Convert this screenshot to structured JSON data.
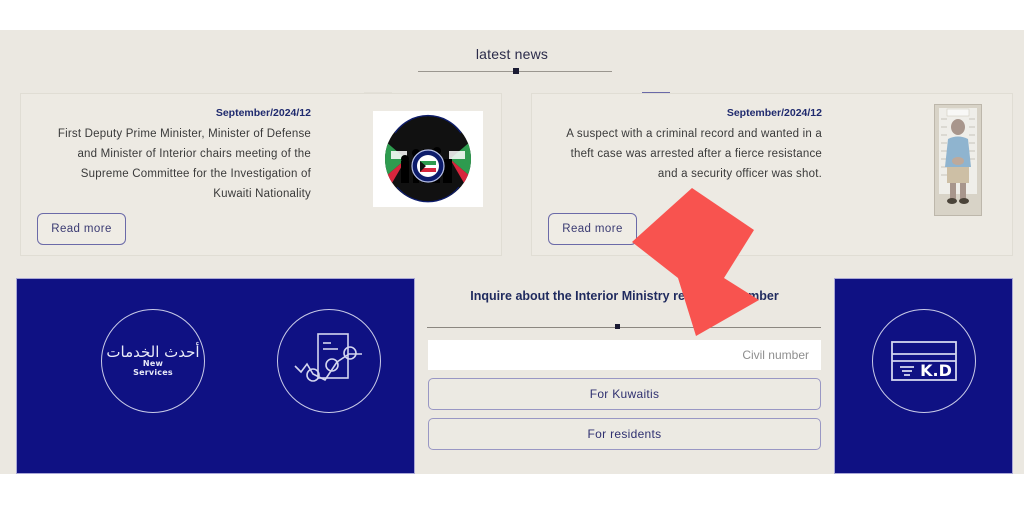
{
  "news": {
    "section_title": "latest news",
    "prev_label": "❮",
    "next_label": "❯",
    "cards": [
      {
        "date": "September/2024/12",
        "text": "First Deputy Prime Minister, Minister of Defense and Minister of Interior chairs meeting of the Supreme Committee for the Investigation of Kuwaiti Nationality",
        "read_more": "Read more",
        "media": "ministry-of-interior-kuwait-logo"
      },
      {
        "date": "September/2024/12",
        "text": "A suspect with a criminal record and wanted in a theft case was arrested after a fierce resistance and a security officer was shot.",
        "read_more": "Read more",
        "media": "suspect-mugshot-photo"
      }
    ]
  },
  "services": {
    "left_panel": {
      "items": [
        {
          "icon": "new-services-circle-icon",
          "label_ar": "أحدث الخدمات",
          "label_en_line1": "New",
          "label_en_line2": "Services"
        },
        {
          "icon": "document-chart-circle-icon",
          "label": ""
        }
      ]
    },
    "middle_circle": {
      "icon": "id-card-reference-number-icon"
    },
    "right_panel": {
      "items": [
        {
          "icon": "payment-card-kd-icon",
          "label": "K.D"
        }
      ]
    }
  },
  "inquire": {
    "title": "Inquire about the Interior Ministry reference number",
    "input_placeholder": "Civil number",
    "input_value": "",
    "buttons": [
      {
        "label": "For Kuwaitis"
      },
      {
        "label": "For residents"
      }
    ]
  },
  "annotation": {
    "cursor_arrow": "red-pointer-arrow",
    "color": "#f8534f"
  },
  "colors": {
    "page_background": "#ebe8e1",
    "panel_blue": "#0f1183",
    "accent_purple": "#7a79b8",
    "text_navy": "#1f2a5e",
    "card_background": "#edeae3",
    "arrow_red": "#f8534f"
  }
}
